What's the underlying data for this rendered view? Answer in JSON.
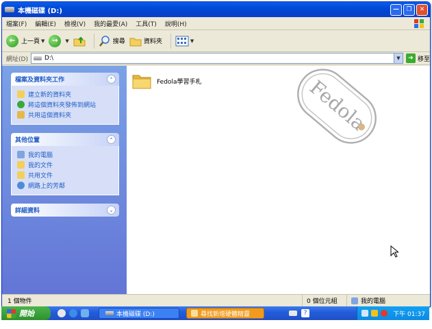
{
  "window": {
    "title": "本機磁碟 (D:)",
    "controls": [
      "minimize",
      "maximize",
      "close"
    ]
  },
  "menubar": {
    "items": [
      "檔案(F)",
      "編輯(E)",
      "檢視(V)",
      "我的最愛(A)",
      "工具(T)",
      "說明(H)"
    ]
  },
  "toolbar": {
    "back_label": "上一頁",
    "search_label": "搜尋",
    "folders_label": "資料夾"
  },
  "address": {
    "label": "網址(D)",
    "value": "D:\\",
    "go_label": "移至"
  },
  "taskpane": {
    "file_tasks": {
      "title": "檔案及資料夾工作",
      "items": [
        "建立新的資料夾",
        "將這個資料夾發佈到網站",
        "共用這個資料夾"
      ]
    },
    "other_places": {
      "title": "其他位置",
      "items": [
        "我的電腦",
        "我的文件",
        "共用文件",
        "網路上的芳鄰"
      ]
    },
    "details": {
      "title": "詳細資料"
    }
  },
  "files": [
    {
      "name": "Fedola學習手札",
      "type": "folder"
    }
  ],
  "watermark": {
    "text": "Fedola"
  },
  "statusbar": {
    "count": "1 個物件",
    "size": "0 個位元組",
    "location": "我的電腦"
  },
  "taskbar": {
    "start_label": "開始",
    "tasks": [
      "本機磁碟 (D:)",
      "尋找新增硬體精靈"
    ],
    "clock": "下午 01:37"
  },
  "colors": {
    "titlebar": "#0047d6",
    "taskpane": "#6f8fe0",
    "link": "#215dc6",
    "start": "#2d902d",
    "active_task": "#f09b1f"
  }
}
